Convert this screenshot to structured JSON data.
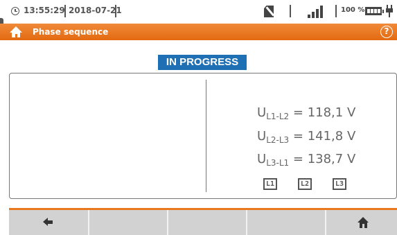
{
  "status_bar": {
    "time": "13:55:29",
    "date": "2018-07-21",
    "battery_level": "100 %",
    "icons": [
      "clock-icon",
      "sd-card-crossed-icon",
      "signal-strength-icon",
      "battery-icon",
      "power-plug-icon"
    ]
  },
  "title_bar": {
    "title": "Phase sequence",
    "home_icon": "home-icon",
    "help_label": "?"
  },
  "status_badge": "IN PROGRESS",
  "readings": [
    {
      "symbol": "U",
      "sub": "L1-L2",
      "value": " = 118,1 V"
    },
    {
      "symbol": "U",
      "sub": "L2-L3",
      "value": " = 141,8 V"
    },
    {
      "symbol": "U",
      "sub": "L3-L1",
      "value": " = 138,7 V"
    }
  ],
  "phases": [
    "L1",
    "L2",
    "L3"
  ],
  "toolbar": {
    "back_icon": "back-arrow-icon",
    "home_icon": "home-icon"
  },
  "colors": {
    "accent": "#e8781f",
    "badge": "#1f6fb5",
    "toolbar": "#d2d2d2"
  }
}
